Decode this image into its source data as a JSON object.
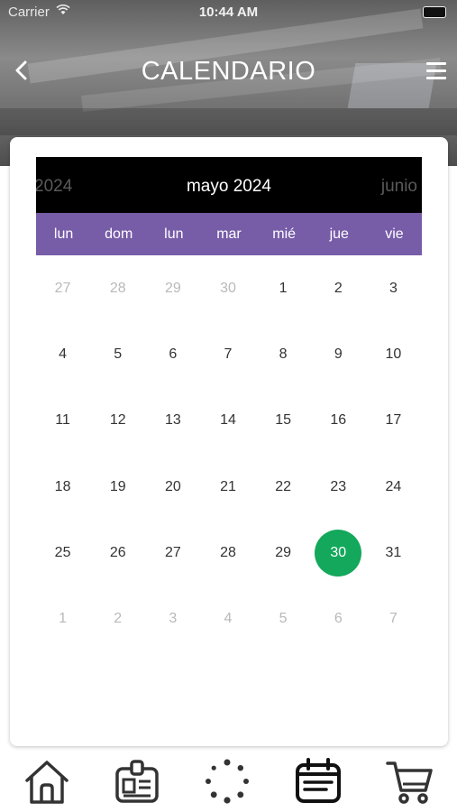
{
  "status_bar": {
    "carrier": "Carrier",
    "time": "10:44 AM"
  },
  "navbar": {
    "back_icon": "chevron-left-icon",
    "title": "CALENDARIO",
    "menu_icon": "hamburger-menu-icon"
  },
  "calendar": {
    "prev_label": "2024",
    "current_label": "mayo 2024",
    "next_label": "junio",
    "weekdays": [
      "lun",
      "dom",
      "lun",
      "mar",
      "mié",
      "jue",
      "vie"
    ],
    "weeks": [
      [
        {
          "d": "27",
          "muted": true
        },
        {
          "d": "28",
          "muted": true
        },
        {
          "d": "29",
          "muted": true
        },
        {
          "d": "30",
          "muted": true
        },
        {
          "d": "1"
        },
        {
          "d": "2"
        },
        {
          "d": "3"
        }
      ],
      [
        {
          "d": "4"
        },
        {
          "d": "5"
        },
        {
          "d": "6"
        },
        {
          "d": "7"
        },
        {
          "d": "8"
        },
        {
          "d": "9"
        },
        {
          "d": "10"
        }
      ],
      [
        {
          "d": "11"
        },
        {
          "d": "12"
        },
        {
          "d": "13"
        },
        {
          "d": "14"
        },
        {
          "d": "15"
        },
        {
          "d": "16"
        },
        {
          "d": "17"
        }
      ],
      [
        {
          "d": "18"
        },
        {
          "d": "19"
        },
        {
          "d": "20"
        },
        {
          "d": "21"
        },
        {
          "d": "22"
        },
        {
          "d": "23"
        },
        {
          "d": "24"
        }
      ],
      [
        {
          "d": "25"
        },
        {
          "d": "26"
        },
        {
          "d": "27"
        },
        {
          "d": "28"
        },
        {
          "d": "29"
        },
        {
          "d": "30",
          "selected": true
        },
        {
          "d": "31"
        }
      ],
      [
        {
          "d": "1",
          "muted": true
        },
        {
          "d": "2",
          "muted": true
        },
        {
          "d": "3",
          "muted": true
        },
        {
          "d": "4",
          "muted": true
        },
        {
          "d": "5",
          "muted": true
        },
        {
          "d": "6",
          "muted": true
        },
        {
          "d": "7",
          "muted": true
        }
      ]
    ],
    "colors": {
      "header_bg": "#000000",
      "weekday_bg": "#775ca8",
      "selected": "#13a85b"
    }
  },
  "tabbar": {
    "items": [
      {
        "icon": "home-icon"
      },
      {
        "icon": "id-card-icon"
      },
      {
        "icon": "loading-dots-icon"
      },
      {
        "icon": "calendar-icon"
      },
      {
        "icon": "cart-icon"
      }
    ]
  }
}
